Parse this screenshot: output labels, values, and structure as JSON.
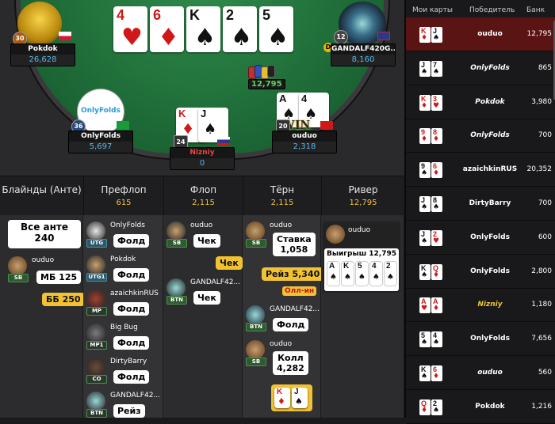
{
  "board": [
    {
      "rank": "4",
      "suit": "♥",
      "color": "red"
    },
    {
      "rank": "6",
      "suit": "♦",
      "color": "red"
    },
    {
      "rank": "K",
      "suit": "♠",
      "color": "blk"
    },
    {
      "rank": "2",
      "suit": "♠",
      "color": "blk"
    },
    {
      "rank": "5",
      "suit": "♠",
      "color": "blk"
    }
  ],
  "pot": "12,795",
  "players": {
    "pokdok": {
      "name": "Pokdok",
      "stack": "26,628",
      "level": "30"
    },
    "gandalf": {
      "name": "GANDALF420G...",
      "stack": "8,160",
      "level": "12"
    },
    "onlyfolds": {
      "name": "OnlyFolds",
      "stack": "5,697",
      "level": "36",
      "logo": "OnlyFolds"
    },
    "nizniy": {
      "name": "Nizniy",
      "stack": "0",
      "level": "24",
      "cards": [
        {
          "rank": "K",
          "suit": "♦",
          "color": "red"
        },
        {
          "rank": "J",
          "suit": "♠",
          "color": "blk"
        }
      ]
    },
    "ouduo": {
      "name": "ouduo",
      "stack": "2,318",
      "level": "20",
      "win_text": "WIN",
      "cards": [
        {
          "rank": "A",
          "suit": "♠",
          "color": "blk"
        },
        {
          "rank": "4",
          "suit": "♠",
          "color": "blk"
        }
      ]
    }
  },
  "streets": [
    {
      "name": "Блайнды (Анте)",
      "pot": ""
    },
    {
      "name": "Префлоп",
      "pot": "615"
    },
    {
      "name": "Флоп",
      "pot": "2,115"
    },
    {
      "name": "Тёрн",
      "pot": "2,115"
    },
    {
      "name": "Ривер",
      "pot": "12,795"
    }
  ],
  "blinds": {
    "ante_label": "Все анте",
    "ante_value": "240",
    "sb_name": "ouduo",
    "sb_action": "МБ 125",
    "bb_action": "ББ 250"
  },
  "preflop": [
    {
      "name": "OnlyFolds",
      "pos": "UTG",
      "action": "Фолд"
    },
    {
      "name": "Pokdok",
      "pos": "UTG1",
      "action": "Фолд"
    },
    {
      "name": "azaichkinRUS",
      "pos": "MP",
      "action": "Фолд"
    },
    {
      "name": "Big Bug",
      "pos": "MP1",
      "action": "Фолд"
    },
    {
      "name": "DirtyBarry",
      "pos": "CO",
      "action": "Фолд"
    },
    {
      "name": "GANDALF42...",
      "pos": "BTN",
      "action": "Рейз"
    }
  ],
  "flop": [
    {
      "name": "ouduo",
      "pos": "SB",
      "action": "Чек"
    },
    {
      "name": "",
      "pos": "",
      "action": "Чек"
    },
    {
      "name": "GANDALF42...",
      "pos": "BTN",
      "action": "Чек"
    }
  ],
  "turn": {
    "p1": {
      "name": "ouduo",
      "pos": "SB",
      "action": "Ставка",
      "amount": "1,058"
    },
    "raise": "Рейз 5,340",
    "allin": "Олл-ин",
    "p2": {
      "name": "GANDALF42...",
      "pos": "BTN",
      "action": "Фолд"
    },
    "p3": {
      "name": "ouduo",
      "pos": "SB",
      "action": "Колл",
      "amount": "4,282"
    },
    "showdown": [
      {
        "rank": "K",
        "suit": "♦",
        "color": "red"
      },
      {
        "rank": "J",
        "suit": "♠",
        "color": "blk"
      }
    ]
  },
  "river": {
    "name": "ouduo",
    "win_text": "Выигрыш 12,795",
    "cards": [
      {
        "rank": "A",
        "suit": "♠",
        "color": "blk"
      },
      {
        "rank": "K",
        "suit": "♠",
        "color": "blk"
      },
      {
        "rank": "5",
        "suit": "♠",
        "color": "blk"
      },
      {
        "rank": "4",
        "suit": "♠",
        "color": "blk"
      },
      {
        "rank": "2",
        "suit": "♠",
        "color": "blk"
      }
    ]
  },
  "history": {
    "headers": {
      "cards": "Мои карты",
      "winner": "Победитель",
      "bank": "Банк"
    },
    "rows": [
      {
        "c1": {
          "rank": "K",
          "suit": "♦",
          "color": "red"
        },
        "c2": {
          "rank": "J",
          "suit": "♠",
          "color": "blk"
        },
        "winner": "ouduo",
        "style": "normal",
        "bank": "12,795",
        "active": true
      },
      {
        "c1": {
          "rank": "J",
          "suit": "♠",
          "color": "blk"
        },
        "c2": {
          "rank": "7",
          "suit": "♠",
          "color": "blk"
        },
        "winner": "OnlyFolds",
        "style": "italic",
        "bank": "865"
      },
      {
        "c1": {
          "rank": "K",
          "suit": "♦",
          "color": "red"
        },
        "c2": {
          "rank": "3",
          "suit": "♥",
          "color": "red"
        },
        "winner": "Pokdok",
        "style": "italic",
        "bank": "3,980"
      },
      {
        "c1": {
          "rank": "9",
          "suit": "♦",
          "color": "red"
        },
        "c2": {
          "rank": "8",
          "suit": "♦",
          "color": "red"
        },
        "winner": "OnlyFolds",
        "style": "italic",
        "bank": "700"
      },
      {
        "c1": {
          "rank": "9",
          "suit": "♠",
          "color": "blk"
        },
        "c2": {
          "rank": "6",
          "suit": "♦",
          "color": "red"
        },
        "winner": "azaichkinRUS",
        "style": "normal",
        "bank": "20,352"
      },
      {
        "c1": {
          "rank": "J",
          "suit": "♠",
          "color": "blk"
        },
        "c2": {
          "rank": "8",
          "suit": "♠",
          "color": "blk"
        },
        "winner": "DirtyBarry",
        "style": "normal",
        "bank": "700"
      },
      {
        "c1": {
          "rank": "J",
          "suit": "♠",
          "color": "blk"
        },
        "c2": {
          "rank": "2",
          "suit": "♥",
          "color": "red"
        },
        "winner": "OnlyFolds",
        "style": "normal",
        "bank": "600"
      },
      {
        "c1": {
          "rank": "K",
          "suit": "♠",
          "color": "blk"
        },
        "c2": {
          "rank": "Q",
          "suit": "♦",
          "color": "red"
        },
        "winner": "OnlyFolds",
        "style": "normal",
        "bank": "2,800"
      },
      {
        "c1": {
          "rank": "A",
          "suit": "♥",
          "color": "red"
        },
        "c2": {
          "rank": "A",
          "suit": "♦",
          "color": "red"
        },
        "winner": "Nizniy",
        "style": "gold",
        "bank": "1,180"
      },
      {
        "c1": {
          "rank": "5",
          "suit": "♠",
          "color": "blk"
        },
        "c2": {
          "rank": "4",
          "suit": "♠",
          "color": "blk"
        },
        "winner": "OnlyFolds",
        "style": "normal",
        "bank": "7,656"
      },
      {
        "c1": {
          "rank": "K",
          "suit": "♠",
          "color": "blk"
        },
        "c2": {
          "rank": "6",
          "suit": "♦",
          "color": "red"
        },
        "winner": "ouduo",
        "style": "italic",
        "bank": "560"
      },
      {
        "c1": {
          "rank": "Q",
          "suit": "♦",
          "color": "red"
        },
        "c2": {
          "rank": "2",
          "suit": "♠",
          "color": "blk"
        },
        "winner": "Pokdok",
        "style": "normal",
        "bank": "1,216"
      }
    ]
  },
  "colors": {
    "felt": "#1f6d39",
    "accent": "#58b8ee",
    "gold": "#f1c232",
    "pot": "#5ad65a"
  }
}
